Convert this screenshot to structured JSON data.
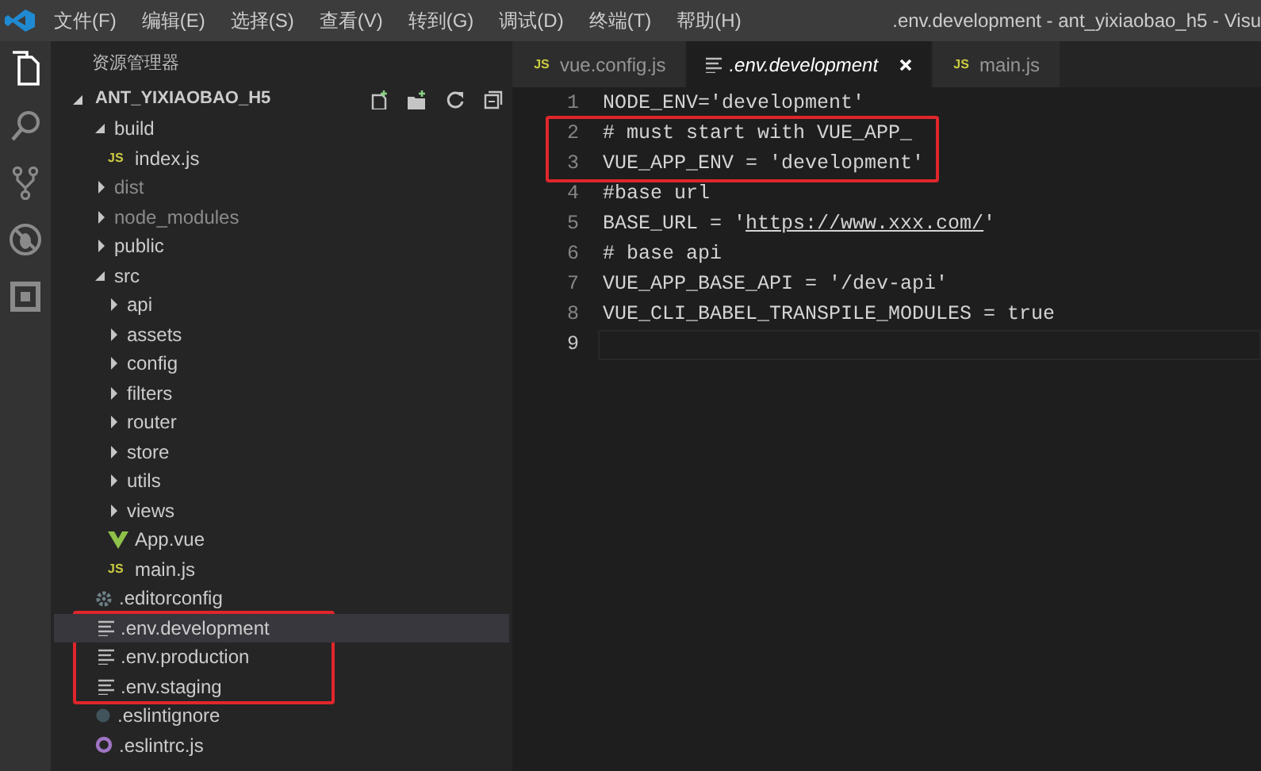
{
  "window": {
    "title": ".env.development - ant_yixiaobao_h5 - Visu"
  },
  "menu": [
    "文件(F)",
    "编辑(E)",
    "选择(S)",
    "查看(V)",
    "转到(G)",
    "调试(D)",
    "终端(T)",
    "帮助(H)"
  ],
  "activity_bar": [
    {
      "kind": "files",
      "selected": true
    },
    {
      "kind": "search",
      "selected": false
    },
    {
      "kind": "branch",
      "selected": false
    },
    {
      "kind": "debug",
      "selected": false
    },
    {
      "kind": "extensions",
      "selected": false
    }
  ],
  "sidebar": {
    "title": "资源管理器",
    "project": "ANT_YIXIAOBAO_H5",
    "items": [
      {
        "label": "build",
        "kind": "folder",
        "expanded": true,
        "dimmed": false,
        "selected": false,
        "highlighted": false,
        "children": [
          {
            "label": "index.js",
            "kind": "js",
            "badge": "JS",
            "dimmed": false,
            "selected": false,
            "highlighted": false
          }
        ]
      },
      {
        "label": "dist",
        "kind": "folder",
        "expanded": false,
        "dimmed": true,
        "selected": false,
        "highlighted": false
      },
      {
        "label": "node_modules",
        "kind": "folder",
        "expanded": false,
        "dimmed": true,
        "selected": false,
        "highlighted": false
      },
      {
        "label": "public",
        "kind": "folder",
        "expanded": false,
        "dimmed": false,
        "selected": false,
        "highlighted": false
      },
      {
        "label": "src",
        "kind": "folder",
        "expanded": true,
        "dimmed": false,
        "selected": false,
        "highlighted": false,
        "children": [
          {
            "label": "api",
            "kind": "folder",
            "expanded": false,
            "dimmed": false,
            "selected": false,
            "highlighted": false
          },
          {
            "label": "assets",
            "kind": "folder",
            "expanded": false,
            "dimmed": false,
            "selected": false,
            "highlighted": false
          },
          {
            "label": "config",
            "kind": "folder",
            "expanded": false,
            "dimmed": false,
            "selected": false,
            "highlighted": false
          },
          {
            "label": "filters",
            "kind": "folder",
            "expanded": false,
            "dimmed": false,
            "selected": false,
            "highlighted": false
          },
          {
            "label": "router",
            "kind": "folder",
            "expanded": false,
            "dimmed": false,
            "selected": false,
            "highlighted": false
          },
          {
            "label": "store",
            "kind": "folder",
            "expanded": false,
            "dimmed": false,
            "selected": false,
            "highlighted": false
          },
          {
            "label": "utils",
            "kind": "folder",
            "expanded": false,
            "dimmed": false,
            "selected": false,
            "highlighted": false
          },
          {
            "label": "views",
            "kind": "folder",
            "expanded": false,
            "dimmed": false,
            "selected": false,
            "highlighted": false
          },
          {
            "label": "App.vue",
            "kind": "vue",
            "dimmed": false,
            "selected": false,
            "highlighted": false
          },
          {
            "label": "main.js",
            "kind": "js",
            "badge": "JS",
            "dimmed": false,
            "selected": false,
            "highlighted": false
          }
        ]
      },
      {
        "label": ".editorconfig",
        "kind": "gear",
        "dimmed": false,
        "selected": false,
        "highlighted": false
      },
      {
        "label": ".env.development",
        "kind": "text",
        "dimmed": false,
        "selected": true,
        "highlighted": true
      },
      {
        "label": ".env.production",
        "kind": "text",
        "dimmed": false,
        "selected": false,
        "highlighted": true
      },
      {
        "label": ".env.staging",
        "kind": "text",
        "dimmed": false,
        "selected": false,
        "highlighted": true
      },
      {
        "label": ".eslintignore",
        "kind": "ignore",
        "dimmed": false,
        "selected": false,
        "highlighted": false
      },
      {
        "label": ".eslintrc.js",
        "kind": "eslint",
        "dimmed": false,
        "selected": false,
        "highlighted": false
      }
    ]
  },
  "tabs": [
    {
      "label": "vue.config.js",
      "kind": "js",
      "badge": "JS",
      "selected": false
    },
    {
      "label": ".env.development",
      "kind": "text",
      "selected": true
    },
    {
      "label": "main.js",
      "kind": "js",
      "badge": "JS",
      "selected": false
    }
  ],
  "editor": {
    "lines": [
      {
        "number": "1",
        "highlighted": false,
        "current": false,
        "segments": [
          {
            "text": "NODE_ENV='development'",
            "link": false
          }
        ]
      },
      {
        "number": "2",
        "highlighted": true,
        "current": false,
        "segments": [
          {
            "text": "# must start with VUE_APP_",
            "link": false
          }
        ]
      },
      {
        "number": "3",
        "highlighted": true,
        "current": false,
        "segments": [
          {
            "text": "VUE_APP_ENV = 'development'",
            "link": false
          }
        ]
      },
      {
        "number": "4",
        "highlighted": false,
        "current": false,
        "segments": [
          {
            "text": "#base url",
            "link": false
          }
        ]
      },
      {
        "number": "5",
        "highlighted": false,
        "current": false,
        "segments": [
          {
            "text": "BASE_URL = '",
            "link": false
          },
          {
            "text": "https://www.xxx.com/",
            "link": true
          },
          {
            "text": "'",
            "link": false
          }
        ]
      },
      {
        "number": "6",
        "highlighted": false,
        "current": false,
        "segments": [
          {
            "text": "# base api",
            "link": false
          }
        ]
      },
      {
        "number": "7",
        "highlighted": false,
        "current": false,
        "segments": [
          {
            "text": "VUE_APP_BASE_API = '/dev-api'",
            "link": false
          }
        ]
      },
      {
        "number": "8",
        "highlighted": false,
        "current": false,
        "segments": [
          {
            "text": "VUE_CLI_BABEL_TRANSPILE_MODULES = true",
            "link": false
          }
        ]
      },
      {
        "number": "9",
        "highlighted": false,
        "current": true
      }
    ]
  }
}
